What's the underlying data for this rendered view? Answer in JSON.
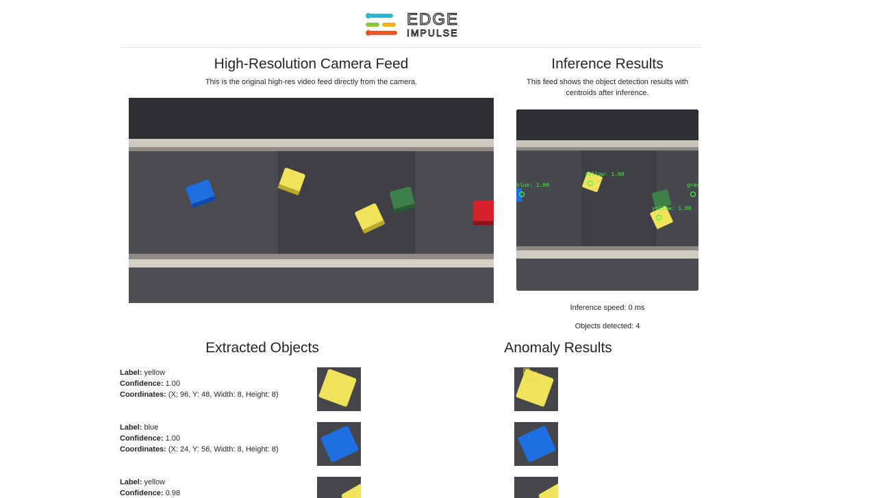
{
  "brand": {
    "line1": "EDGE",
    "line2": "IMPULSE"
  },
  "camera": {
    "title": "High-Resolution Camera Feed",
    "description": "This is the original high-res video feed directly from the camera."
  },
  "inference": {
    "title": "Inference Results",
    "description_line1": "This feed shows the object detection results with",
    "description_line2": "centroids after inference.",
    "speed": "Inference speed: 0 ms",
    "objects": "Objects detected: 4",
    "boxes": [
      {
        "label": "blue: 1.00"
      },
      {
        "label": "yellow: 1.00"
      },
      {
        "label": "green"
      },
      {
        "label": "yellow: 1.00"
      }
    ]
  },
  "extracted": {
    "title": "Extracted Objects",
    "labels": {
      "label": "Label:",
      "confidence": "Confidence:",
      "coordinates": "Coordinates:"
    },
    "items": [
      {
        "label": "yellow",
        "confidence": "1.00",
        "coordinates": "(X: 96, Y: 48, Width: 8, Height: 8)",
        "color": "#e8d84a"
      },
      {
        "label": "blue",
        "confidence": "1.00",
        "coordinates": "(X: 24, Y: 56, Width: 8, Height: 8)",
        "color": "#1f6fe0"
      },
      {
        "label": "yellow",
        "confidence": "0.98",
        "color": "#e8d84a"
      }
    ]
  },
  "anomaly": {
    "title": "Anomaly Results"
  },
  "colors": {
    "yellow": "#e8d84a",
    "blue": "#1f6fe0",
    "green": "#3f7f4a",
    "red": "#d3212c",
    "detect": "#39ff3a"
  }
}
